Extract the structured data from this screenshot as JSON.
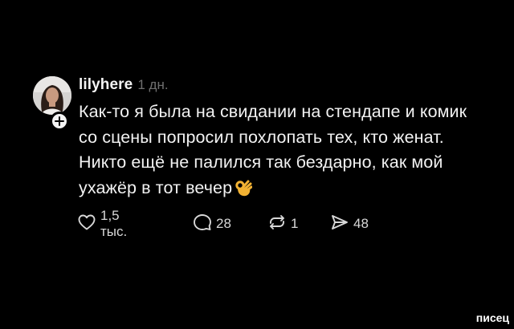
{
  "post": {
    "username": "lilyhere",
    "time": "1 дн.",
    "text_lines": [
      "Как-то я была на свидании на стендапе и комик",
      "со сцены попросил похлопать тех, кто женат.",
      "Никто ещё не палился так бездарно, как мой",
      "ухажёр в тот вечер"
    ],
    "emoji": "ok-hand-emoji"
  },
  "actions": {
    "likes": "1,5 тыс.",
    "replies": "28",
    "reposts": "1",
    "shares": "48"
  },
  "watermark": "писец",
  "colors": {
    "background": "#000000",
    "text": "#f2f2f2",
    "muted": "#6f6f6f"
  }
}
